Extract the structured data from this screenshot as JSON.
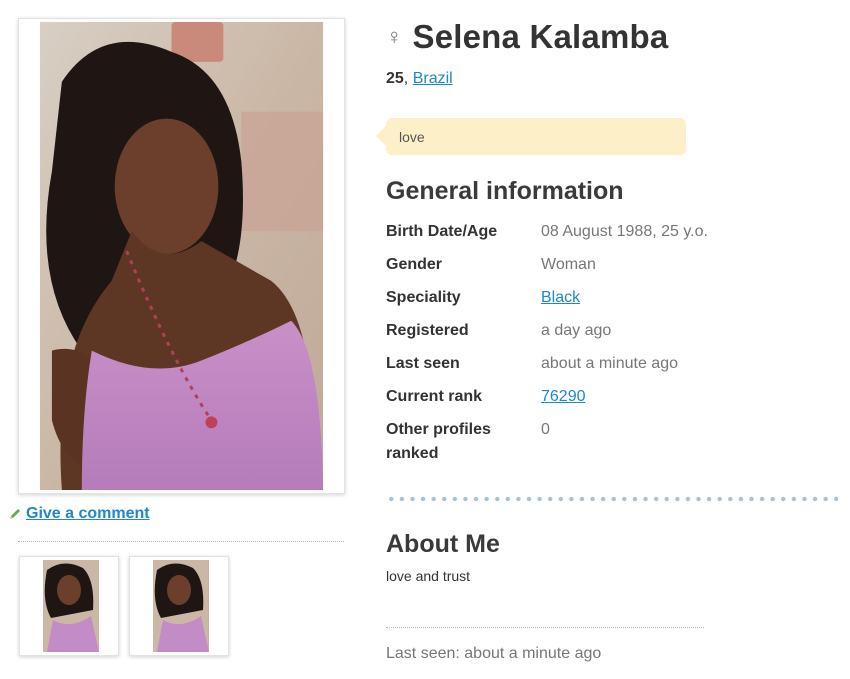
{
  "profile": {
    "name": "Selena Kalamba",
    "gender_symbol": "♀",
    "age": "25",
    "age_separator": ", ",
    "country": "Brazil",
    "status": "love"
  },
  "photos": {
    "main_alt": "profile photo",
    "thumbs": [
      "photo thumbnail",
      "photo thumbnail"
    ]
  },
  "actions": {
    "comment_label": "Give a comment"
  },
  "general": {
    "title": "General information",
    "rows": [
      {
        "label": "Birth Date/Age",
        "value": "08 August 1988, 25 y.o."
      },
      {
        "label": "Gender",
        "value": "Woman"
      },
      {
        "label": "Speciality",
        "value": "Black"
      },
      {
        "label": "Registered",
        "value": "a day ago"
      },
      {
        "label": "Last seen",
        "value": "about a minute ago"
      },
      {
        "label": "Current rank",
        "value": "76290"
      },
      {
        "label": "Other profiles ranked",
        "value": "0"
      }
    ]
  },
  "about": {
    "title": "About Me",
    "text": "love and trust",
    "footer": "Last seen: about a minute ago"
  },
  "colors": {
    "link": "#1e88c8",
    "status_bg": "#fdf0c8",
    "separator_dot": "#a9c3d4"
  }
}
